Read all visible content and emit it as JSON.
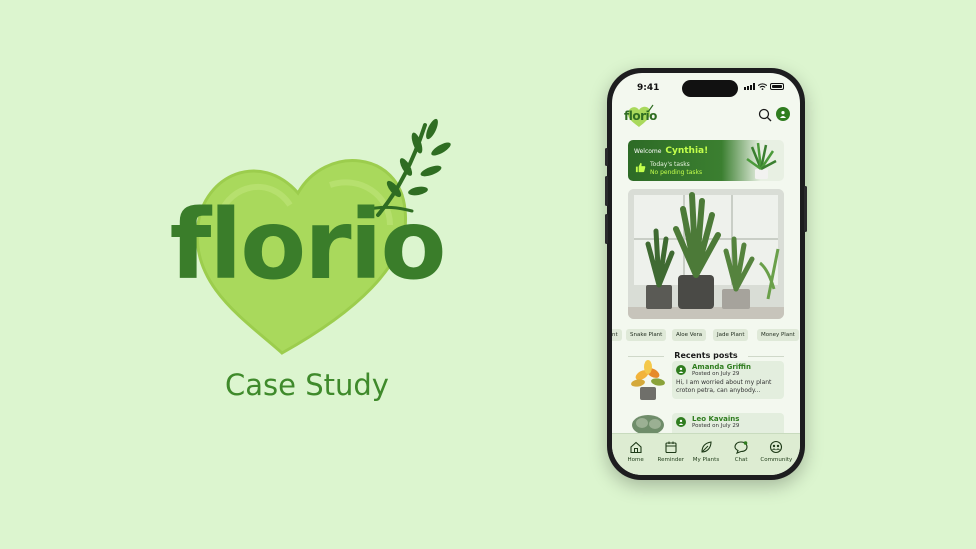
{
  "brand": {
    "logo_text": "florio",
    "subtitle": "Case Study"
  },
  "colors": {
    "background": "#dcf5cf",
    "heart": "#a9d95c",
    "brand_green": "#3a7d2a",
    "accent_lime": "#c3ff4c"
  },
  "phone": {
    "status": {
      "time": "9:41"
    },
    "app": {
      "logo_text": "florio",
      "icons": [
        "search-icon",
        "profile-icon"
      ]
    },
    "welcome": {
      "greeting": "Welcome",
      "user_name": "Cynthia!",
      "tasks_label": "Today's tasks",
      "tasks_status": "No pending tasks"
    },
    "categories": [
      "nt",
      "Snake Plant",
      "Aloe Vera",
      "Jade Plant",
      "Money Plant"
    ],
    "recent": {
      "title": "Recents posts",
      "posts": [
        {
          "author": "Amanda Griffin",
          "date": "Posted on July 29",
          "text": "Hi, I am worried about my plant croton petra, can anybody..."
        },
        {
          "author": "Leo Kavains",
          "date": "Posted on July 29",
          "text": ""
        }
      ]
    },
    "tabs": [
      {
        "label": "Home",
        "icon": "home-icon"
      },
      {
        "label": "Reminder",
        "icon": "calendar-icon"
      },
      {
        "label": "My Plants",
        "icon": "leaf-icon"
      },
      {
        "label": "Chat",
        "icon": "chat-icon"
      },
      {
        "label": "Community",
        "icon": "community-icon"
      }
    ]
  }
}
